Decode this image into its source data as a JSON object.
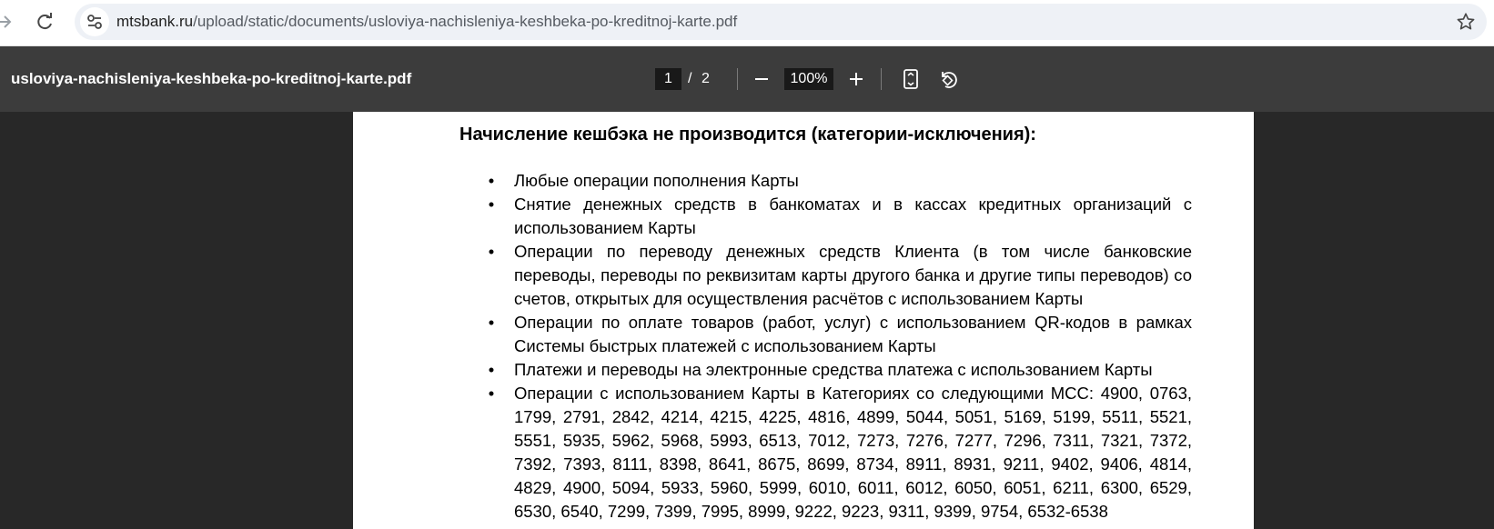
{
  "browser": {
    "url_host": "mtsbank.ru",
    "url_path": "/upload/static/documents/usloviya-nachisleniya-keshbeka-po-kreditnoj-karte.pdf"
  },
  "toolbar": {
    "file_title": "usloviya-nachisleniya-keshbeka-po-kreditnoj-karte.pdf",
    "current_page": "1",
    "page_separator": "/",
    "total_pages": "2",
    "zoom": "100%"
  },
  "document": {
    "heading": "Начисление кешбэка не производится (категории-исключения):",
    "bullet_symbol": "•",
    "items": [
      "Любые операции пополнения Карты",
      "Снятие денежных средств в банкоматах и в кассах кредитных организаций с использованием Карты",
      "Операции по переводу денежных средств Клиента (в том числе банковские переводы, переводы по реквизитам карты другого банка и другие типы переводов) со счетов, открытых для осуществления расчётов с использованием Карты",
      "Операции по оплате товаров (работ, услуг) с использованием QR-кодов в рамках Системы быстрых платежей с использованием Карты",
      "Платежи и переводы на электронные средства платежа с использованием Карты",
      "Операции с использованием Карты в Категориях со следующими MCC: 4900, 0763, 1799, 2791, 2842, 4214, 4215, 4225, 4816, 4899, 5044, 5051, 5169, 5199, 5511, 5521, 5551, 5935, 5962, 5968, 5993, 6513, 7012, 7273, 7276, 7277, 7296, 7311, 7321, 7372, 7392, 7393, 8111, 8398, 8641, 8675, 8699, 8734, 8911, 8931, 9211, 9402, 9406, 4814, 4829, 4900, 5094, 5933, 5960, 5999, 6010, 6011, 6012, 6050, 6051, 6211, 6300, 6529, 6530, 6540, 7299, 7399, 7995, 8999, 9222, 9223, 9311, 9399, 9754, 6532-6538"
    ]
  },
  "colors": {
    "toolbar_bg": "#3c3c3c",
    "viewer_bg": "#282828",
    "omnibox_bg": "#eef1f6",
    "input_bg": "#191919"
  },
  "icons": {
    "forward": "arrow-right-icon",
    "reload": "reload-icon",
    "site_info": "tune-icon",
    "bookmark": "star-icon",
    "zoom_out": "minus-icon",
    "zoom_in": "plus-icon",
    "fit": "fit-page-icon",
    "rotate": "rotate-icon"
  }
}
